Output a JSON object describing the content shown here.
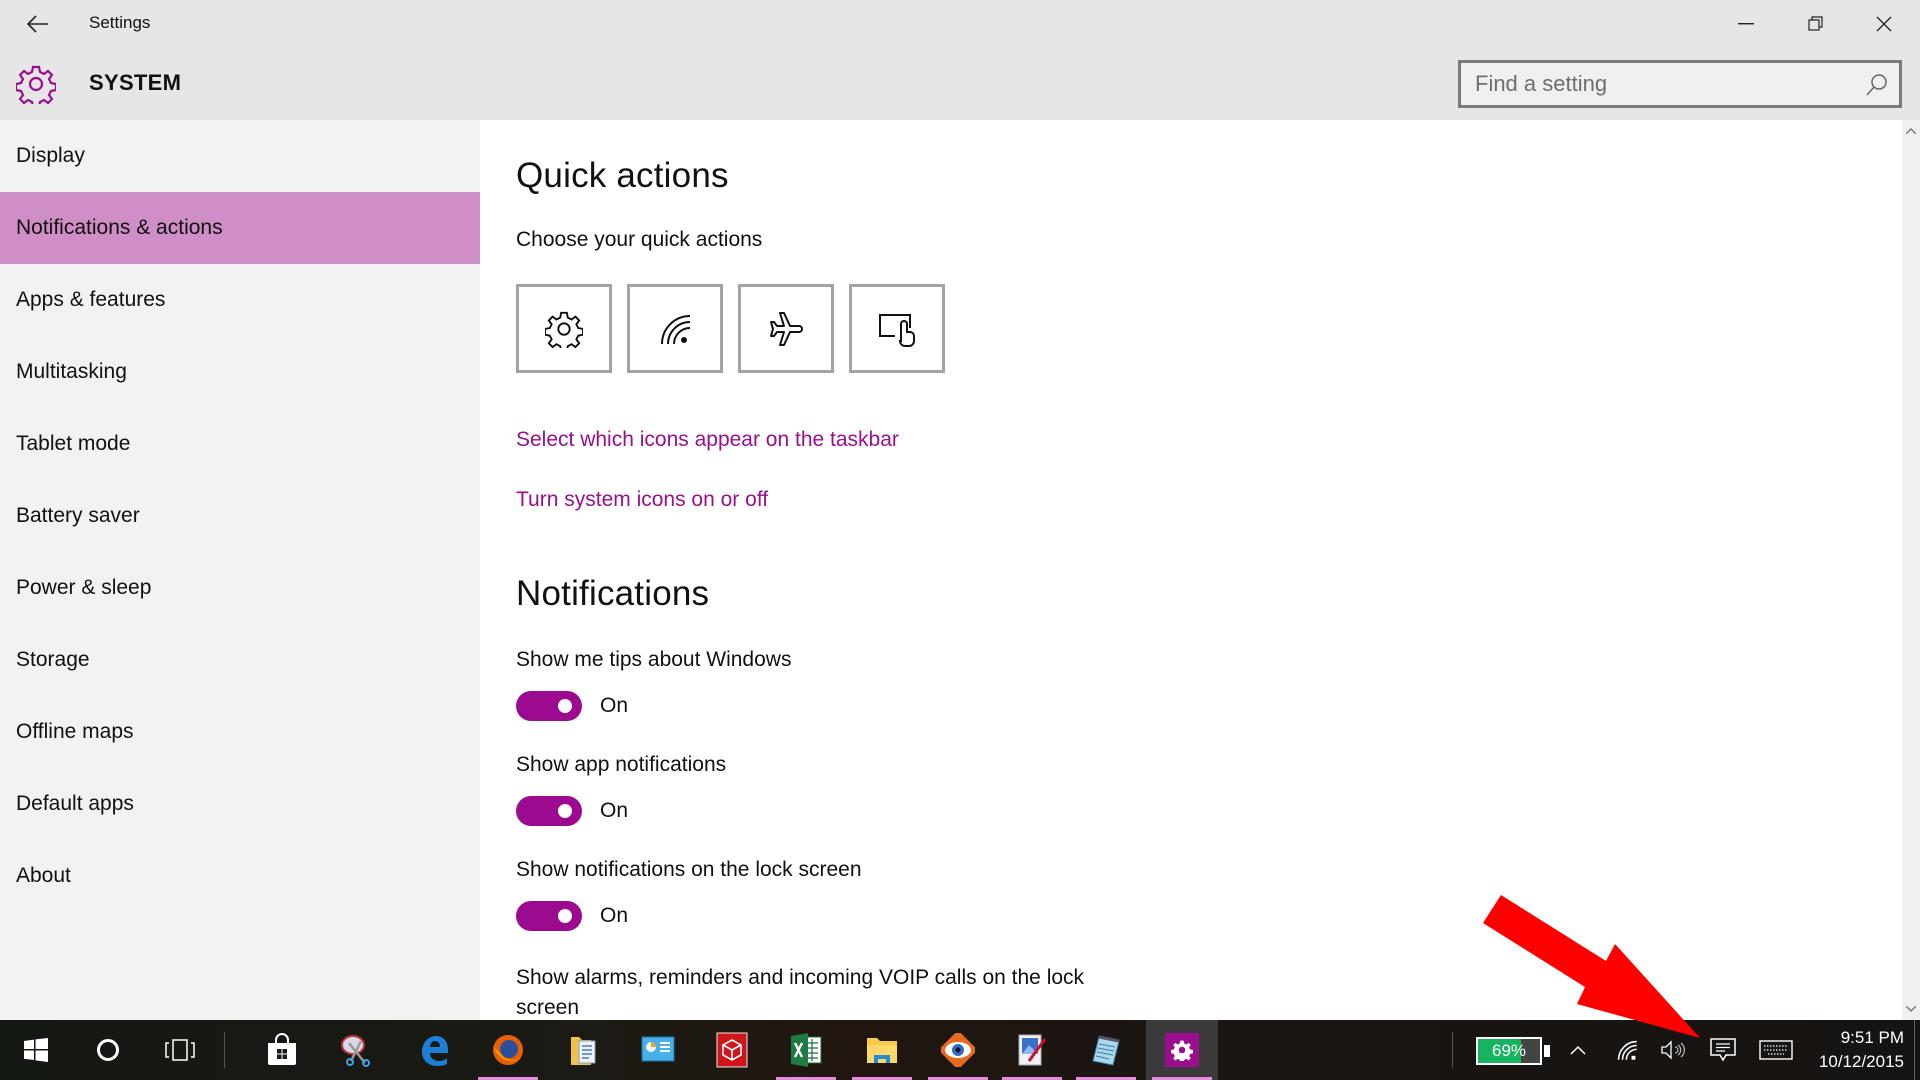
{
  "window": {
    "app_title": "Settings",
    "back_icon": "back-arrow-icon",
    "controls": [
      "minimize",
      "restore",
      "close"
    ]
  },
  "header": {
    "section_title": "SYSTEM",
    "section_icon": "gear-icon",
    "search": {
      "placeholder": "Find a setting",
      "value": ""
    }
  },
  "sidebar": {
    "items": [
      {
        "label": "Display",
        "active": false
      },
      {
        "label": "Notifications & actions",
        "active": true
      },
      {
        "label": "Apps & features",
        "active": false
      },
      {
        "label": "Multitasking",
        "active": false
      },
      {
        "label": "Tablet mode",
        "active": false
      },
      {
        "label": "Battery saver",
        "active": false
      },
      {
        "label": "Power & sleep",
        "active": false
      },
      {
        "label": "Storage",
        "active": false
      },
      {
        "label": "Offline maps",
        "active": false
      },
      {
        "label": "Default apps",
        "active": false
      },
      {
        "label": "About",
        "active": false
      }
    ]
  },
  "content": {
    "quick_actions": {
      "heading": "Quick actions",
      "subheading": "Choose your quick actions",
      "tiles": [
        {
          "name": "all-settings",
          "icon": "gear-icon"
        },
        {
          "name": "network",
          "icon": "wifi-icon"
        },
        {
          "name": "airplane-mode",
          "icon": "airplane-icon"
        },
        {
          "name": "tablet-mode",
          "icon": "tablet-mode-icon"
        }
      ],
      "links": [
        "Select which icons appear on the taskbar",
        "Turn system icons on or off"
      ]
    },
    "notifications": {
      "heading": "Notifications",
      "settings": [
        {
          "label": "Show me tips about Windows",
          "state": "On",
          "on": true
        },
        {
          "label": "Show app notifications",
          "state": "On",
          "on": true
        },
        {
          "label": "Show notifications on the lock screen",
          "state": "On",
          "on": true
        },
        {
          "label": "Show alarms, reminders and incoming VOIP calls on the lock screen"
        }
      ]
    }
  },
  "taskbar": {
    "apps": [
      {
        "name": "start",
        "icon": "windows-start-icon"
      },
      {
        "name": "cortana",
        "icon": "cortana-circle-icon"
      },
      {
        "name": "task-view",
        "icon": "task-view-icon"
      },
      {
        "name": "store",
        "icon": "store-bag-icon",
        "running": false
      },
      {
        "name": "snipping-tool",
        "icon": "scissors-icon",
        "running": false
      },
      {
        "name": "edge",
        "icon": "edge-e-icon",
        "running": false
      },
      {
        "name": "firefox",
        "icon": "firefox-icon",
        "running": true
      },
      {
        "name": "file-manager",
        "icon": "documents-folder-icon",
        "running": false
      },
      {
        "name": "control-panel",
        "icon": "control-panel-icon",
        "running": false
      },
      {
        "name": "3d-app",
        "icon": "red-cube-icon",
        "running": false
      },
      {
        "name": "excel",
        "icon": "excel-icon",
        "running": true
      },
      {
        "name": "file-explorer",
        "icon": "folder-icon",
        "running": true
      },
      {
        "name": "faststone",
        "icon": "eye-icon",
        "running": true
      },
      {
        "name": "paint",
        "icon": "paint-icon",
        "running": true
      },
      {
        "name": "notepad",
        "icon": "notepad-icon",
        "running": true
      },
      {
        "name": "settings",
        "icon": "gear-icon",
        "running": true,
        "active": true
      }
    ],
    "tray": {
      "battery_percent": "69%",
      "battery_level": 0.69,
      "icons": [
        "chevron-up-icon",
        "wifi-icon",
        "volume-icon",
        "action-center-icon",
        "keyboard-icon"
      ],
      "time": "9:51 PM",
      "date": "10/12/2015"
    }
  },
  "colors": {
    "accent": "#9b0f8f",
    "selected_nav": "#cf8ec6",
    "annotation_arrow": "#ff0000"
  }
}
